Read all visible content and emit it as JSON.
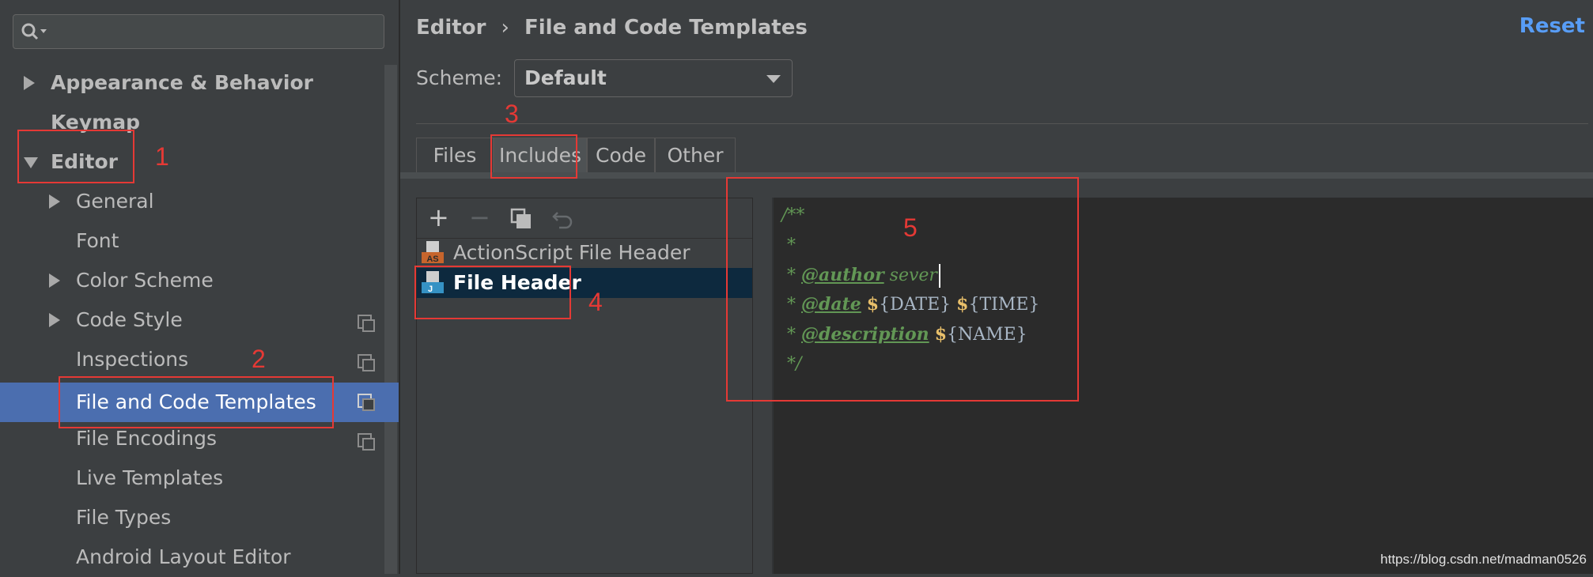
{
  "sidebar": {
    "search": {
      "placeholder": ""
    },
    "items": [
      {
        "label": "Appearance & Behavior"
      },
      {
        "label": "Keymap"
      },
      {
        "label": "Editor"
      },
      {
        "label": "General"
      },
      {
        "label": "Font"
      },
      {
        "label": "Color Scheme"
      },
      {
        "label": "Code Style"
      },
      {
        "label": "Inspections"
      },
      {
        "label": "File and Code Templates"
      },
      {
        "label": "File Encodings"
      },
      {
        "label": "Live Templates"
      },
      {
        "label": "File Types"
      },
      {
        "label": "Android Layout Editor"
      }
    ]
  },
  "header": {
    "breadcrumb": [
      "Editor",
      "›",
      "File and Code Templates"
    ],
    "reset_label": "Reset"
  },
  "scheme": {
    "label": "Scheme:",
    "value": "Default"
  },
  "tabs": [
    {
      "label": "Files"
    },
    {
      "label": "Includes",
      "active": true
    },
    {
      "label": "Code"
    },
    {
      "label": "Other"
    }
  ],
  "toolbar": {
    "add": "+",
    "remove": "−",
    "copy": "copy-icon",
    "reset": "revert-icon"
  },
  "templates": [
    {
      "label": "ActionScript File Header",
      "icon_badge": "AS"
    },
    {
      "label": "File Header",
      "icon_badge": "J",
      "selected": true
    }
  ],
  "editor": {
    "lines": [
      "/**",
      " *",
      " * ",
      " * ",
      " * ",
      " */"
    ],
    "author_tag": "@author",
    "author_value": "sever",
    "date_tag": "@date",
    "date_var1": "{DATE}",
    "date_var2": "{TIME}",
    "desc_tag": "@description",
    "desc_var": "{NAME}",
    "dollar": "$"
  },
  "annotations": [
    "1",
    "2",
    "3",
    "4",
    "5"
  ],
  "watermark": "https://blog.csdn.net/madman0526",
  "colors": {
    "selection": "#4b6eaf",
    "accent": "#589df6",
    "annotation": "#e53935"
  }
}
